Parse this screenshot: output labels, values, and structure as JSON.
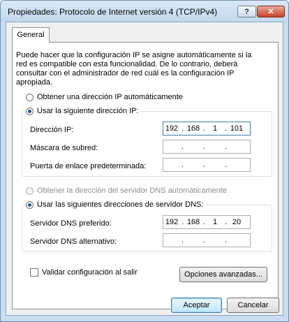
{
  "window": {
    "title": "Propiedades: Protocolo de Internet versión 4 (TCP/IPv4)",
    "help_label": "?",
    "close_label": "✕"
  },
  "tabs": [
    {
      "label": "General"
    }
  ],
  "description": "Puede hacer que la configuración IP se asigne automáticamente si la red es compatible con esta funcionalidad. De lo contrario, deberá consultar con el administrador de red cuál es la configuración IP apropiada.",
  "ip_section": {
    "auto_label": "Obtener una dirección IP automáticamente",
    "manual_label": "Usar la siguiente dirección IP:",
    "selected": "manual",
    "fields": [
      {
        "label": "Dirección IP:",
        "octets": [
          "192",
          "168",
          "1",
          "101"
        ]
      },
      {
        "label": "Máscara de subred:",
        "octets": [
          "",
          "",
          "",
          ""
        ]
      },
      {
        "label": "Puerta de enlace predeterminada:",
        "octets": [
          "",
          "",
          "",
          ""
        ]
      }
    ]
  },
  "dns_section": {
    "auto_label": "Obtener la dirección del servidor DNS automáticamente",
    "manual_label": "Usar las siguientes direcciones de servidor DNS:",
    "selected": "manual",
    "fields": [
      {
        "label": "Servidor DNS preferido:",
        "octets": [
          "192",
          "168",
          "1",
          "20"
        ]
      },
      {
        "label": "Servidor DNS alternativo:",
        "octets": [
          "",
          "",
          "",
          ""
        ]
      }
    ]
  },
  "validate_label": "Validar configuración al salir",
  "validate_checked": false,
  "buttons": {
    "advanced": "Opciones avanzadas...",
    "ok": "Aceptar",
    "cancel": "Cancelar"
  }
}
